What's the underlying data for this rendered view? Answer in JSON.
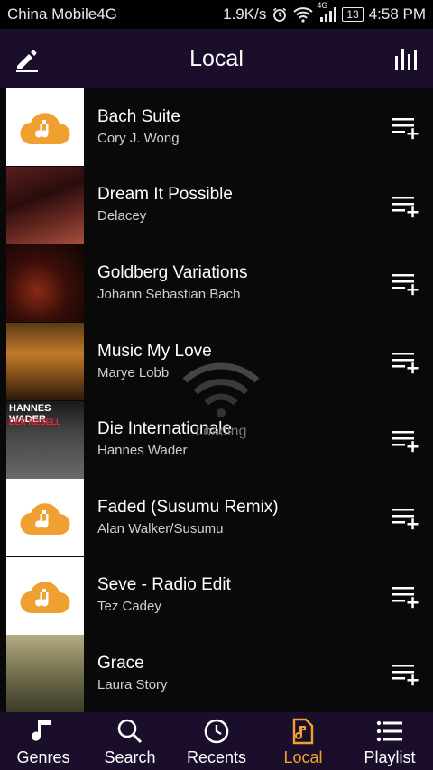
{
  "status_bar": {
    "carrier": "China Mobile4G",
    "speed": "1.9K/s",
    "network_badge": "4G",
    "battery": "13",
    "time": "4:58 PM"
  },
  "header": {
    "title": "Local",
    "left_icon": "edit-pencil-icon",
    "right_icon": "equalizer-icon"
  },
  "songs": [
    {
      "title": "Bach Suite",
      "artist": "Cory J. Wong",
      "art": "default"
    },
    {
      "title": "Dream It Possible",
      "artist": "Delacey",
      "art": "dream"
    },
    {
      "title": "Goldberg Variations",
      "artist": "Johann Sebastian Bach",
      "art": "goldberg"
    },
    {
      "title": "Music My Love",
      "artist": "Marye Lobb",
      "art": "music"
    },
    {
      "title": "Die Internationale",
      "artist": "Hannes Wader",
      "art": "die",
      "art_text": "HANNES WADER",
      "art_text2": "DER REBELL"
    },
    {
      "title": "Faded (Susumu Remix)",
      "artist": "Alan Walker/Susumu",
      "art": "default"
    },
    {
      "title": "Seve - Radio Edit",
      "artist": "Tez Cadey",
      "art": "default"
    },
    {
      "title": "Grace",
      "artist": "Laura Story",
      "art": "grace"
    }
  ],
  "overlay": {
    "text": "Loading",
    "icon": "wifi-icon"
  },
  "nav": [
    {
      "label": "Genres",
      "icon": "music-note-icon",
      "active": false
    },
    {
      "label": "Search",
      "icon": "search-icon",
      "active": false
    },
    {
      "label": "Recents",
      "icon": "clock-icon",
      "active": false
    },
    {
      "label": "Local",
      "icon": "music-file-icon",
      "active": true
    },
    {
      "label": "Playlist",
      "icon": "list-icon",
      "active": false
    }
  ],
  "colors": {
    "accent": "#f0a030",
    "header_bg": "#1a0e2a",
    "list_bg": "#0a090a"
  }
}
